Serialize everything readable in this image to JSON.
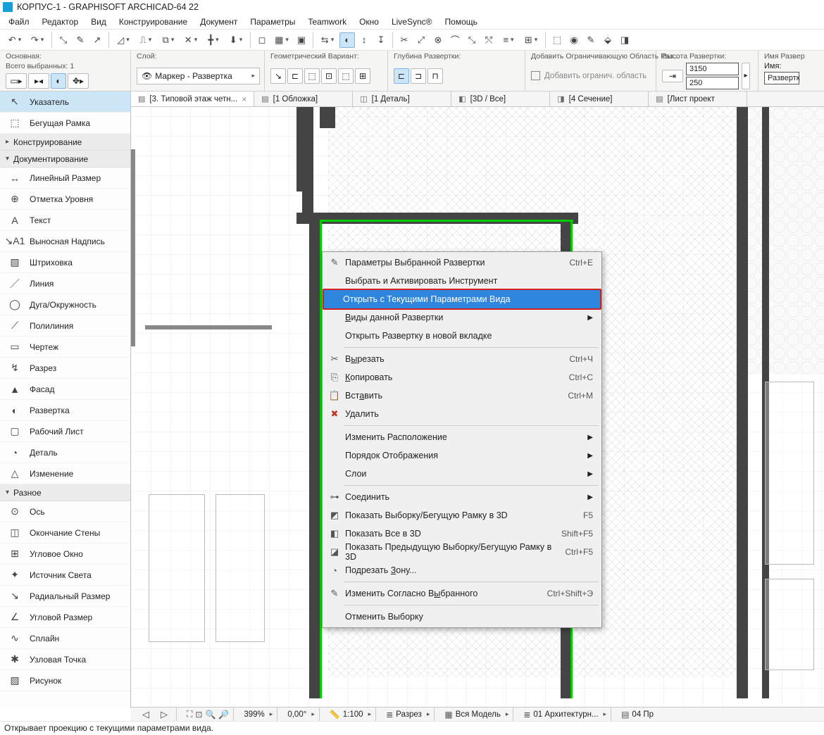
{
  "title": "КОРПУС-1 - GRAPHISOFT ARCHICAD-64 22",
  "menu": [
    "Файл",
    "Редактор",
    "Вид",
    "Конструирование",
    "Документ",
    "Параметры",
    "Teamwork",
    "Окно",
    "LiveSync®",
    "Помощь"
  ],
  "info_panels": {
    "main_label": "Основная:",
    "selected_count_label": "Всего выбранных: 1",
    "layer_label": "Слой:",
    "layer_value": "Маркер - Развертка",
    "geom_label": "Геометрический Вариант:",
    "depth_label": "Глубина Развертки:",
    "bound_label": "Добавить Ограничивающую Область Раз...",
    "bound_check": "Добавить огранич. область",
    "height_label": "Высота Развертки:",
    "height_top": "3150",
    "height_bot": "250",
    "name_panel_label": "Имя Развер",
    "name_field_label": "Имя:",
    "name_value": "Развертк"
  },
  "tabs": [
    {
      "icon": "▤",
      "label": "[3. Типовой этаж четн...",
      "close": "×",
      "active": true
    },
    {
      "icon": "▤",
      "label": "[1 Обложка]"
    },
    {
      "icon": "◫",
      "label": "[1 Деталь]"
    },
    {
      "icon": "◧",
      "label": "[3D / Все]"
    },
    {
      "icon": "◨",
      "label": "[4 Сечение]"
    },
    {
      "icon": "▤",
      "label": "[Лист проект"
    }
  ],
  "toolbox": {
    "pointer": "Указатель",
    "marquee": "Бегущая Рамка",
    "cat_construct": "Конструирование",
    "cat_doc": "Документирование",
    "doc_tools": [
      {
        "icon": "↔",
        "label": "Линейный Размер"
      },
      {
        "icon": "⊕",
        "label": "Отметка Уровня"
      },
      {
        "icon": "A",
        "label": "Текст"
      },
      {
        "icon": "↘A1",
        "label": "Выносная Надпись"
      },
      {
        "icon": "▨",
        "label": "Штриховка"
      },
      {
        "icon": "／",
        "label": "Линия"
      },
      {
        "icon": "◯",
        "label": "Дуга/Окружность"
      },
      {
        "icon": "⟋",
        "label": "Полилиния"
      },
      {
        "icon": "▭",
        "label": "Чертеж"
      },
      {
        "icon": "↯",
        "label": "Разрез"
      },
      {
        "icon": "▲",
        "label": "Фасад"
      },
      {
        "icon": "◐",
        "label": "Развертка"
      },
      {
        "icon": "▢",
        "label": "Рабочий Лист"
      },
      {
        "icon": "◔",
        "label": "Деталь"
      },
      {
        "icon": "△",
        "label": "Изменение"
      }
    ],
    "cat_misc": "Разное",
    "misc_tools": [
      {
        "icon": "⊙",
        "label": "Ось"
      },
      {
        "icon": "◫",
        "label": "Окончание Стены"
      },
      {
        "icon": "⊞",
        "label": "Угловое Окно"
      },
      {
        "icon": "✦",
        "label": "Источник Света"
      },
      {
        "icon": "↘",
        "label": "Радиальный Размер"
      },
      {
        "icon": "∠",
        "label": "Угловой Размер"
      },
      {
        "icon": "∿",
        "label": "Сплайн"
      },
      {
        "icon": "✱",
        "label": "Узловая Точка"
      },
      {
        "icon": "▨",
        "label": "Рисунок"
      }
    ]
  },
  "context_menu": [
    {
      "type": "item",
      "icon": "✎",
      "label": "Параметры Выбранной Развертки",
      "shortcut": "Ctrl+E"
    },
    {
      "type": "item",
      "label": "Выбрать и Активировать Инструмент"
    },
    {
      "type": "highlight",
      "label": "Открыть с Текущими Параметрами Вида"
    },
    {
      "type": "submenu",
      "label_pre": "",
      "ul": "В",
      "label_post": "иды данной Развертки"
    },
    {
      "type": "item",
      "label": "Открыть Развертку в новой вкладке"
    },
    {
      "type": "sep"
    },
    {
      "type": "item",
      "icon": "✂",
      "label_pre": "В",
      "ul": "ы",
      "label_post": "резать",
      "shortcut": "Ctrl+Ч"
    },
    {
      "type": "item",
      "icon": "⎘",
      "label_pre": "",
      "ul": "К",
      "label_post": "опировать",
      "shortcut": "Ctrl+C"
    },
    {
      "type": "item",
      "icon": "📋",
      "label_pre": "Вст",
      "ul": "а",
      "label_post": "вить",
      "shortcut": "Ctrl+M"
    },
    {
      "type": "item",
      "icon": "✖",
      "label": "Удалить",
      "iconcolor": "#c0392b"
    },
    {
      "type": "sep"
    },
    {
      "type": "submenu",
      "label": "Изменить Расположение"
    },
    {
      "type": "submenu",
      "label": "Порядок Отображения"
    },
    {
      "type": "submenu",
      "label": "Слои"
    },
    {
      "type": "sep"
    },
    {
      "type": "submenu",
      "icon": "⊶",
      "label": "Соединить"
    },
    {
      "type": "item",
      "icon": "◩",
      "label": "Показать Выборку/Бегущую Рамку в 3D",
      "shortcut": "F5"
    },
    {
      "type": "item",
      "icon": "◧",
      "label": "Показать Все в 3D",
      "shortcut": "Shift+F5"
    },
    {
      "type": "item",
      "icon": "◪",
      "label": "Показать Предыдущую Выборку/Бегущую Рамку в 3D",
      "shortcut": "Ctrl+F5"
    },
    {
      "type": "item",
      "icon": "◔",
      "label_pre": "Подрезать ",
      "ul": "З",
      "label_post": "ону..."
    },
    {
      "type": "sep"
    },
    {
      "type": "item",
      "icon": "✎",
      "label_pre": "Изменить Согласно В",
      "ul": "ы",
      "label_post": "бранного",
      "shortcut": "Ctrl+Shift+Э"
    },
    {
      "type": "sep"
    },
    {
      "type": "item",
      "label": "Отменить Выборку"
    }
  ],
  "statusbar": {
    "zoom": "399%",
    "angle": "0,00°",
    "scale": "1:100",
    "section": "Разрез",
    "model": "Вся Модель",
    "layer_combo": "01 Архитектурн...",
    "sheet": "04 Пр"
  },
  "hint": "Открывает проекцию с текущими параметрами вида."
}
